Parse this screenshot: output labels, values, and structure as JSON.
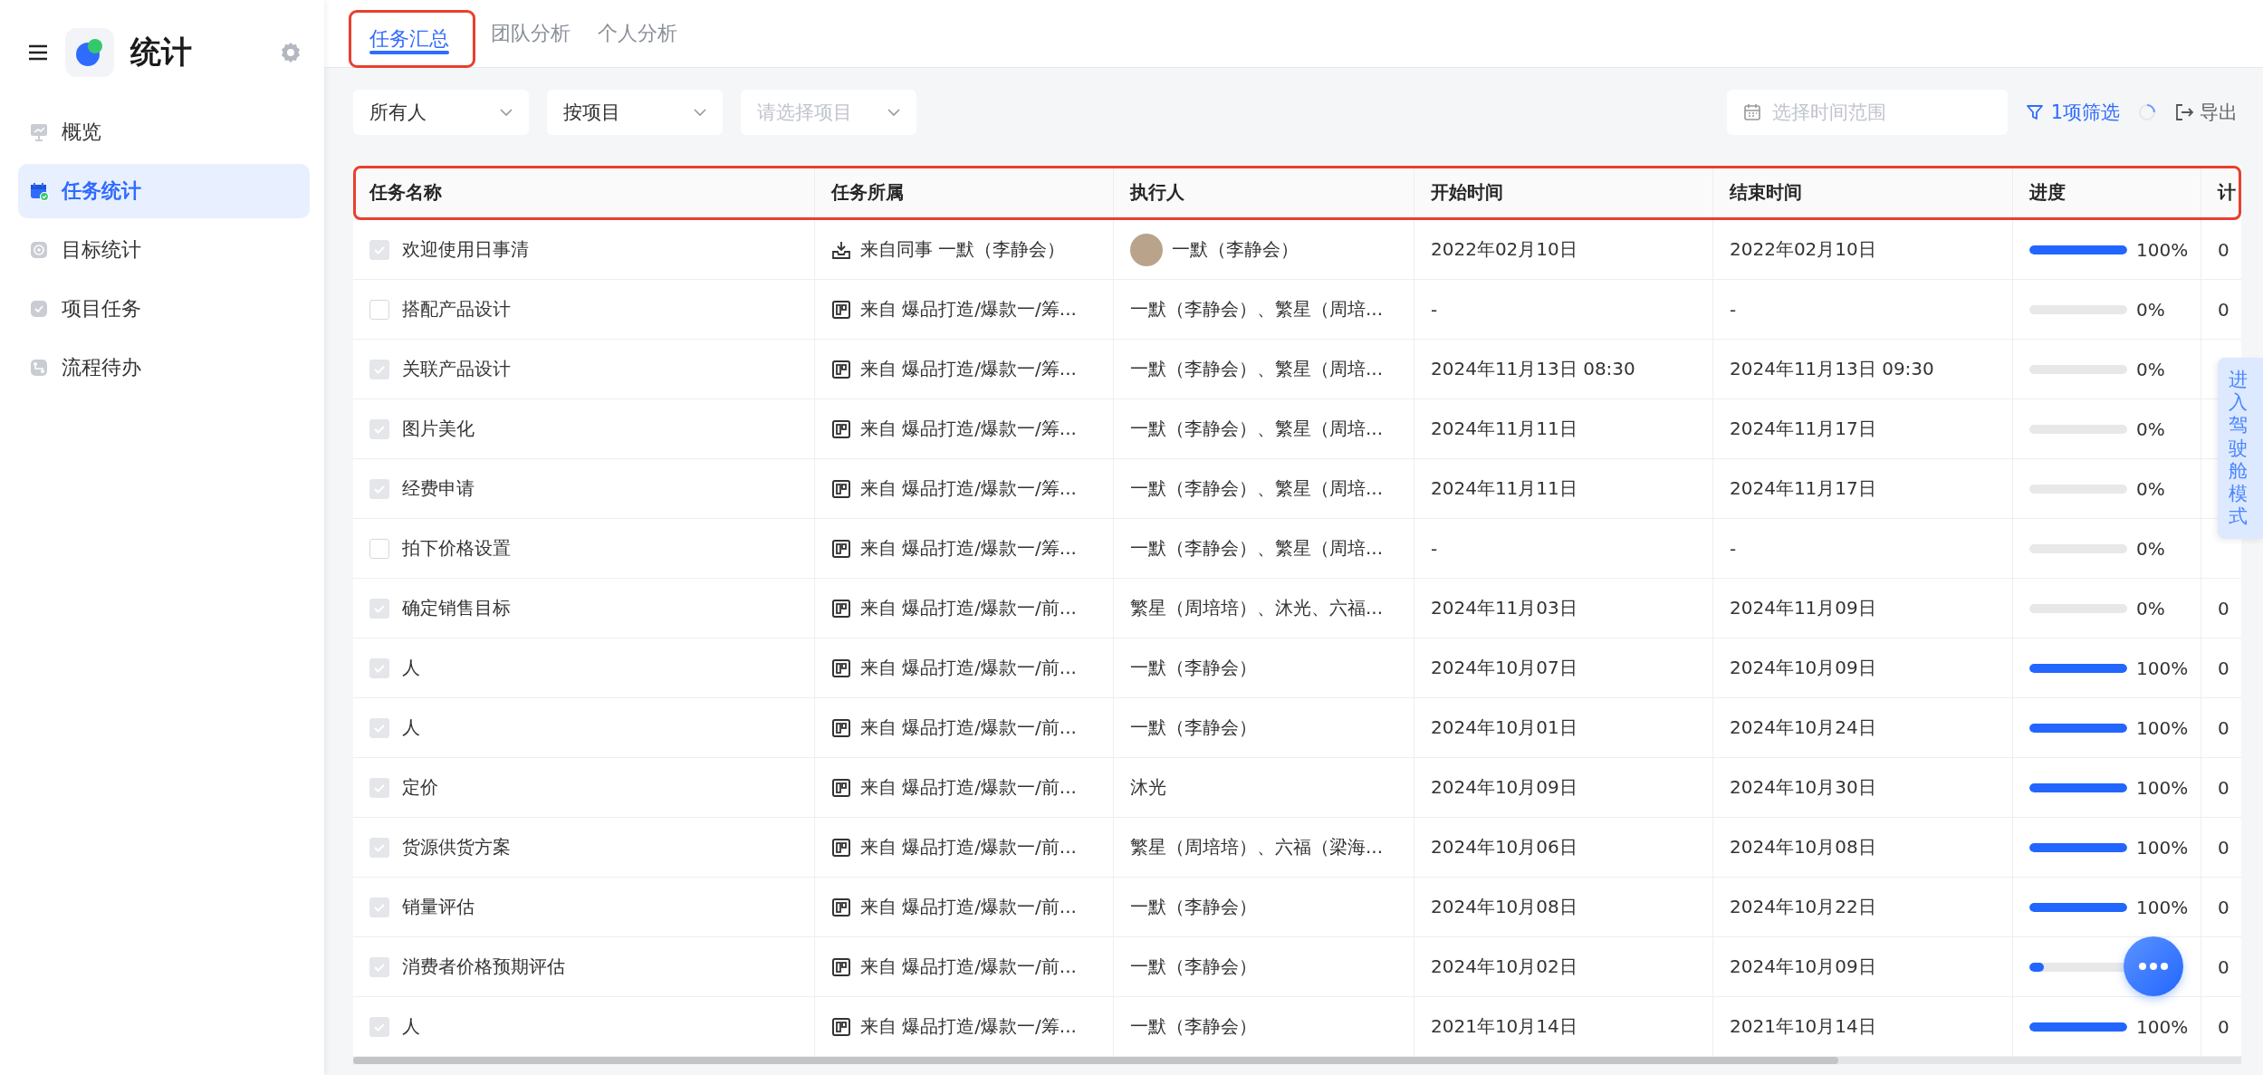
{
  "sidebar": {
    "title": "统计",
    "items": [
      {
        "label": "概览",
        "selected": false
      },
      {
        "label": "任务统计",
        "selected": true
      },
      {
        "label": "目标统计",
        "selected": false
      },
      {
        "label": "项目任务",
        "selected": false
      },
      {
        "label": "流程待办",
        "selected": false
      }
    ]
  },
  "tabs": [
    {
      "label": "任务汇总",
      "selected": true,
      "highlighted": true
    },
    {
      "label": "团队分析",
      "selected": false,
      "highlighted": false
    },
    {
      "label": "个人分析",
      "selected": false,
      "highlighted": false
    }
  ],
  "filters": {
    "dropdowns": [
      {
        "value": "所有人"
      },
      {
        "value": "按项目"
      },
      {
        "placeholder": "请选择项目"
      }
    ],
    "date_range": {
      "placeholder": "选择时间范围"
    },
    "filter_count": "1项筛选",
    "export": "导出"
  },
  "table": {
    "header_highlighted": true,
    "columns": [
      "任务名称",
      "任务所属",
      "执行人",
      "开始时间",
      "结束时间",
      "进度",
      "计"
    ],
    "rows": [
      {
        "checked": true,
        "name": "欢迎使用日事清",
        "source": {
          "kind": "colleague",
          "text": "来自同事 一默（李静会）"
        },
        "assignee": {
          "avatar": true,
          "text": "一默（李静会）"
        },
        "start": "2022年02月10日",
        "end": "2022年02月10日",
        "progress": {
          "level": 1,
          "reading": "100%"
        },
        "column_7": "0"
      },
      {
        "checked": false,
        "name": "搭配产品设计",
        "source": {
          "kind": "project",
          "text": "来自 爆品打造/爆款一/筹..."
        },
        "assignee": {
          "avatar": false,
          "text": "一默（李静会）、繁星（周培..."
        },
        "start": "-",
        "end": "-",
        "progress": {
          "level": 0,
          "reading": "0%"
        },
        "column_7": "0"
      },
      {
        "checked": true,
        "name": "关联产品设计",
        "source": {
          "kind": "project",
          "text": "来自 爆品打造/爆款一/筹..."
        },
        "assignee": {
          "avatar": false,
          "text": "一默（李静会）、繁星（周培..."
        },
        "start": "2024年11月13日 08:30",
        "end": "2024年11月13日 09:30",
        "progress": {
          "level": 0,
          "reading": "0%"
        }
      },
      {
        "checked": true,
        "name": "图片美化",
        "source": {
          "kind": "project",
          "text": "来自 爆品打造/爆款一/筹..."
        },
        "assignee": {
          "avatar": false,
          "text": "一默（李静会）、繁星（周培..."
        },
        "start": "2024年11月11日",
        "end": "2024年11月17日",
        "progress": {
          "level": 0,
          "reading": "0%"
        }
      },
      {
        "checked": true,
        "name": "经费申请",
        "source": {
          "kind": "project",
          "text": "来自 爆品打造/爆款一/筹..."
        },
        "assignee": {
          "avatar": false,
          "text": "一默（李静会）、繁星（周培..."
        },
        "start": "2024年11月11日",
        "end": "2024年11月17日",
        "progress": {
          "level": 0,
          "reading": "0%"
        }
      },
      {
        "checked": false,
        "name": "拍下价格设置",
        "source": {
          "kind": "project",
          "text": "来自 爆品打造/爆款一/筹..."
        },
        "assignee": {
          "avatar": false,
          "text": "一默（李静会）、繁星（周培..."
        },
        "start": "-",
        "end": "-",
        "progress": {
          "level": 0,
          "reading": "0%"
        }
      },
      {
        "checked": true,
        "name": "确定销售目标",
        "source": {
          "kind": "project",
          "text": "来自 爆品打造/爆款一/前..."
        },
        "assignee": {
          "avatar": false,
          "text": "繁星（周培培）、沐光、六福..."
        },
        "start": "2024年11月03日",
        "end": "2024年11月09日",
        "progress": {
          "level": 0,
          "reading": "0%"
        },
        "column_7": "0"
      },
      {
        "checked": true,
        "name": "人",
        "source": {
          "kind": "project",
          "text": "来自 爆品打造/爆款一/前..."
        },
        "assignee": {
          "avatar": false,
          "text": "一默（李静会）"
        },
        "start": "2024年10月07日",
        "end": "2024年10月09日",
        "progress": {
          "level": 1,
          "reading": "100%"
        },
        "column_7": "0"
      },
      {
        "checked": true,
        "name": "人",
        "source": {
          "kind": "project",
          "text": "来自 爆品打造/爆款一/前..."
        },
        "assignee": {
          "avatar": false,
          "text": "一默（李静会）"
        },
        "start": "2024年10月01日",
        "end": "2024年10月24日",
        "progress": {
          "level": 1,
          "reading": "100%"
        },
        "column_7": "0"
      },
      {
        "checked": true,
        "name": "定价",
        "source": {
          "kind": "project",
          "text": "来自 爆品打造/爆款一/前..."
        },
        "assignee": {
          "avatar": false,
          "text": "沐光"
        },
        "start": "2024年10月09日",
        "end": "2024年10月30日",
        "progress": {
          "level": 1,
          "reading": "100%"
        },
        "column_7": "0"
      },
      {
        "checked": true,
        "name": "货源供货方案",
        "source": {
          "kind": "project",
          "text": "来自 爆品打造/爆款一/前..."
        },
        "assignee": {
          "avatar": false,
          "text": "繁星（周培培）、六福（梁海..."
        },
        "start": "2024年10月06日",
        "end": "2024年10月08日",
        "progress": {
          "level": 1,
          "reading": "100%"
        },
        "column_7": "0"
      },
      {
        "checked": true,
        "name": "销量评估",
        "source": {
          "kind": "project",
          "text": "来自 爆品打造/爆款一/前..."
        },
        "assignee": {
          "avatar": false,
          "text": "一默（李静会）"
        },
        "start": "2024年10月08日",
        "end": "2024年10月22日",
        "progress": {
          "level": 1,
          "reading": "100%"
        },
        "column_7": "0"
      },
      {
        "checked": true,
        "name": "消费者价格预期评估",
        "source": {
          "kind": "project",
          "text": "来自 爆品打造/爆款一/前..."
        },
        "assignee": {
          "avatar": false,
          "text": "一默（李静会）"
        },
        "start": "2024年10月02日",
        "end": "2024年10月09日",
        "progress": {
          "level": 0.15
        },
        "column_7": "0"
      },
      {
        "checked": true,
        "name": "人",
        "source": {
          "kind": "project",
          "text": "来自 爆品打造/爆款一/筹..."
        },
        "assignee": {
          "avatar": false,
          "text": "一默（李静会）"
        },
        "start": "2021年10月14日",
        "end": "2021年10月14日",
        "progress": {
          "level": 1,
          "reading": "100%"
        },
        "column_7": "0"
      }
    ]
  },
  "side_tab": "进入驾驶舱模式"
}
